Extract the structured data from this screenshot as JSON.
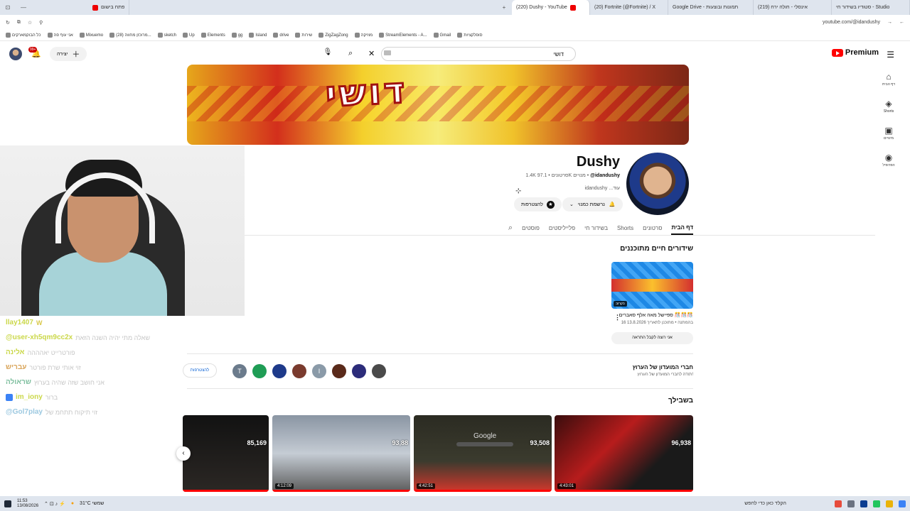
{
  "browser": {
    "tabs": [
      {
        "title": "(220) Dushy - YouTube",
        "active": true
      },
      {
        "title": "(20) Fortnite (@Fortnite) / X"
      },
      {
        "title": "Google Drive - תמונות ובוצעות"
      },
      {
        "title": "(219) אינסלי - חולה ירח"
      },
      {
        "title": "סטודיו בשידור חי - Studio"
      }
    ],
    "left_tab": "פתח בישום",
    "url": "youtube.com/@idandushy",
    "bookmarks": [
      "כל הבוקמארקים",
      "אני עוף פה",
      "Mixuemo",
      "(28) מרוכזן מחווה...",
      "sketch",
      "Up",
      "Elements",
      "gg",
      "Island",
      "drive",
      "שירות",
      "ZigZagZong",
      "מוזיקה",
      "StreamElements - A...",
      "Gmail",
      "סופלקציות"
    ]
  },
  "masthead": {
    "logo": "Premium",
    "search_value": "דושי",
    "create_label": "יצירה",
    "notification_count": "99+"
  },
  "guide": [
    {
      "icon": "home-icon",
      "label": "דף הבית"
    },
    {
      "icon": "shorts-icon",
      "label": "Shorts"
    },
    {
      "icon": "subscriptions-icon",
      "label": "מינויים"
    },
    {
      "icon": "you-icon",
      "label": "הפרופיל"
    }
  ],
  "banner": {
    "title": "דושי"
  },
  "channel": {
    "name": "Dushy",
    "handle": "@idandushy",
    "subscribers": "97.1K מנויים",
    "videos": "1.4K סרטונים",
    "description": "idandushy ...עוד",
    "subscribed_label": "נרשמת כמנוי",
    "join_label": "להצטרפות"
  },
  "tabs": [
    {
      "label": "דף הבית",
      "active": true
    },
    {
      "label": "סרטונים"
    },
    {
      "label": "Shorts"
    },
    {
      "label": "בשידור חי"
    },
    {
      "label": "פלייליסטים"
    },
    {
      "label": "פוסטים"
    }
  ],
  "live_section": {
    "title": "שידורים חיים מתוכננים",
    "video_title": "ספיישל מאה אלף סאברים 🎊🎊🎊",
    "badge": "בקרוב",
    "date": "16 בהמתנה • מתוכנן לתאריך 13.8.2026",
    "remind_label": "אני רוצה לקבל התראה"
  },
  "members": {
    "title": "חברי המועדון של הערוץ",
    "subtitle": "תודה לחברי המועדון של הערוץ!",
    "join_label": "להצטרפות",
    "avatars": [
      {
        "letter": "T",
        "color": "#6b7b8c"
      },
      {
        "letter": "",
        "color": "#1f9d55"
      },
      {
        "letter": "",
        "color": "#1e3a8a"
      },
      {
        "letter": "",
        "color": "#7a3b2e"
      },
      {
        "letter": "I",
        "color": "#8a9aa8"
      },
      {
        "letter": "",
        "color": "#5a2a1a"
      },
      {
        "letter": "",
        "color": "#2c2c7a"
      },
      {
        "letter": "",
        "color": "#4a4a4a"
      }
    ]
  },
  "for_you": {
    "title": "בשבילך",
    "videos": [
      {
        "views": "96,938",
        "duration": "4:43:01"
      },
      {
        "views": "93,508",
        "duration": "4:42:51"
      },
      {
        "views": "93,88",
        "duration": "4:12:09"
      },
      {
        "views": "85,169",
        "duration": ""
      }
    ]
  },
  "chat": [
    {
      "user": "llay1407",
      "msg": "W"
    },
    {
      "user": "@user-xh5qm9cc2x",
      "msg": "שאלה מתי יהיה השנה הזאת"
    },
    {
      "user": "אלינה",
      "msg": "פורטרייט יאהההה"
    },
    {
      "user": "עבריש",
      "msg": "זוי אותי שרת פורטר"
    },
    {
      "user": "שראולה",
      "msg": "אני חושב שזה שהיה בערוץ"
    },
    {
      "user": "im_iony",
      "msg": "ברור"
    },
    {
      "user": "@Gol7play",
      "msg": "זוי תיקוח תתחמ של"
    }
  ],
  "taskbar": {
    "time": "11:53",
    "date": "13/08/2026",
    "weather": "31°C שמשי",
    "search_placeholder": "הקלד כאן כדי לחפש"
  }
}
